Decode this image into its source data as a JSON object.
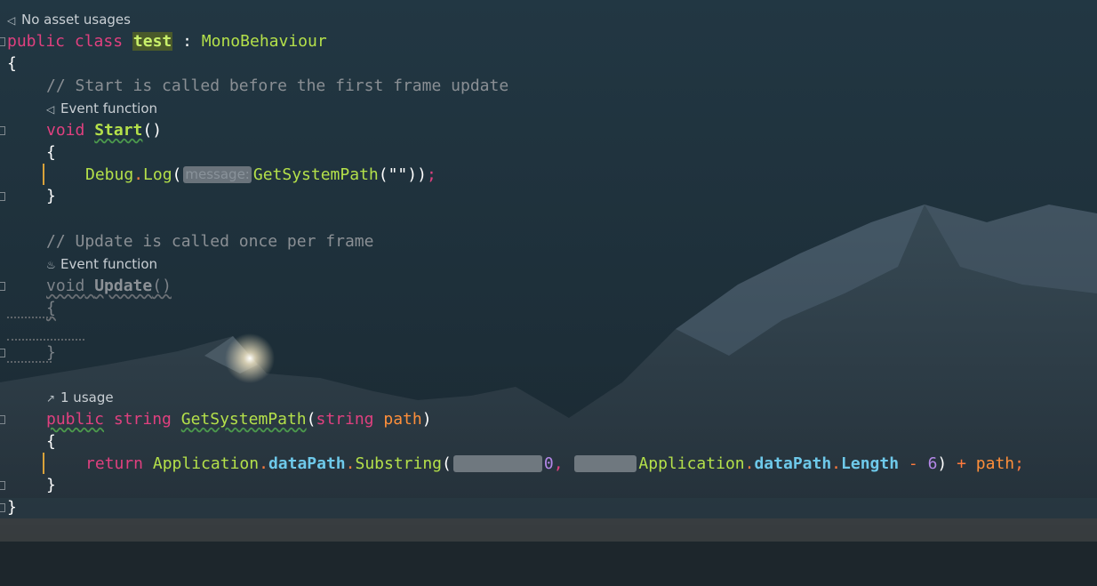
{
  "hints": {
    "no_asset_usages": "No asset usages",
    "event_function_start": "Event function",
    "event_function_update": "Event function",
    "usages_count": "1 usage"
  },
  "code": {
    "line1": {
      "public": "public",
      "class": "class",
      "name": "test",
      "colon": ":",
      "base": "MonoBehaviour"
    },
    "open_brace_class": "{",
    "comment_start": "// Start is called before the first frame update",
    "start_sig": {
      "void": "void",
      "name": "Start",
      "parens": "()"
    },
    "start_open": "{",
    "debug_line": {
      "debug": "Debug",
      "dot": ".",
      "log": "Log",
      "open": "(",
      "param_hint": "message:",
      "call": "GetSystemPath",
      "args": "(\"\"))",
      "semi": ";"
    },
    "start_close": "}",
    "comment_update": "// Update is called once per frame",
    "update_sig": {
      "void": "void",
      "name": "Update",
      "parens": "()"
    },
    "update_open": "{",
    "update_close": "}",
    "getpath_sig": {
      "public": "public",
      "string": "string",
      "name": "GetSystemPath",
      "open": "(",
      "ptype": "string",
      "pname": "path",
      "close": ")"
    },
    "getpath_open": "{",
    "return_line": {
      "return": "return",
      "app1": "Application",
      "dot1": ".",
      "datapath1": "dataPath",
      "dot2": ".",
      "substring": "Substring",
      "open": "(",
      "zero": "0",
      "comma": ",",
      "app2": "Application",
      "dot3": ".",
      "datapath2": "dataPath",
      "dot4": ".",
      "length": "Length",
      "minus": "-",
      "six": "6",
      "close": ")",
      "plus": "+",
      "path": "path",
      "semi": ";"
    },
    "getpath_close": "}",
    "class_close": "}"
  },
  "icons": {
    "unity_icon": "unity-icon",
    "flame_icon": "flame-icon",
    "usage_icon": "external-link-icon"
  },
  "colors": {
    "keyword": "#e0407f",
    "type_and_method": "#b4e04a",
    "property": "#6ec9ea",
    "comment": "#8a8f94",
    "number": "#b487e8",
    "operator": "#ff7a3c"
  }
}
